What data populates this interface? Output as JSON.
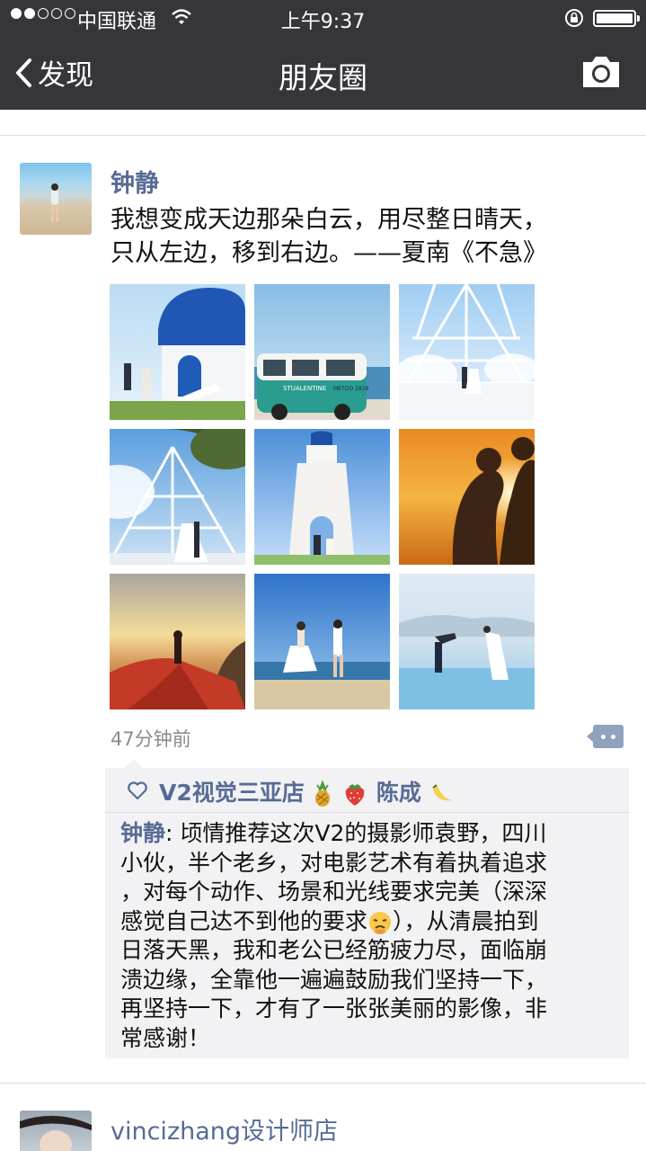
{
  "status_bar": {
    "carrier": "中国联通",
    "time": "上午9:37"
  },
  "nav": {
    "back_label": "发现",
    "title": "朋友圈"
  },
  "post": {
    "author": "钟静",
    "text_lines": [
      "我想变成天边那朵白云，用尽整日晴天，",
      "只从左边，移到右边。——夏南《不急》"
    ],
    "timestamp": "47分钟前",
    "photo_count": 9,
    "van_sign_1": "STUALENTINE",
    "van_sign_2": "METOO 1838",
    "likes": {
      "names": [
        "V2视觉三亚店",
        "陈成"
      ]
    },
    "comment": {
      "author": "钟静",
      "separator": ": ",
      "lines": [
        "顷情推荐这次V2的摄影师袁野，四川",
        "小伙，半个老乡，对电影艺术有着执着追求",
        "，对每个动作、场景和光线要求完美（深深",
        "感觉自己达不到他的要求",
        "），从清晨拍到",
        "日落天黑，我和老公已经筋疲力尽，面临崩",
        "溃边缘，全靠他一遍遍鼓励我们坚持一下，",
        "再坚持一下，才有了一张张美丽的影像，非",
        "常感谢！"
      ]
    }
  },
  "next_post": {
    "author": "vincizhang设计师店"
  }
}
